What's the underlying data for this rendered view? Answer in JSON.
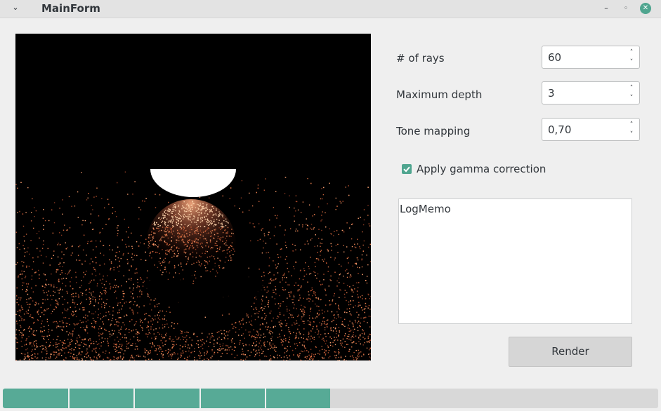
{
  "window": {
    "title": "MainForm",
    "menu_icon": "chevron-down-icon",
    "minimize_icon": "minimize-icon",
    "maximize_icon": "maximize-icon",
    "close_icon": "close-icon",
    "accent_color": "#4fa58f"
  },
  "settings": {
    "rays": {
      "label": "# of rays",
      "value": "60"
    },
    "depth": {
      "label": "Maximum depth",
      "value": "3"
    },
    "tone": {
      "label": "Tone mapping",
      "value": "0,70"
    },
    "gamma": {
      "label": "Apply gamma correction",
      "checked": true
    }
  },
  "log": {
    "text": "LogMemo"
  },
  "render_button": {
    "label": "Render"
  },
  "progress": {
    "fraction": 0.5,
    "color": "#57aa96",
    "segments": 5
  }
}
